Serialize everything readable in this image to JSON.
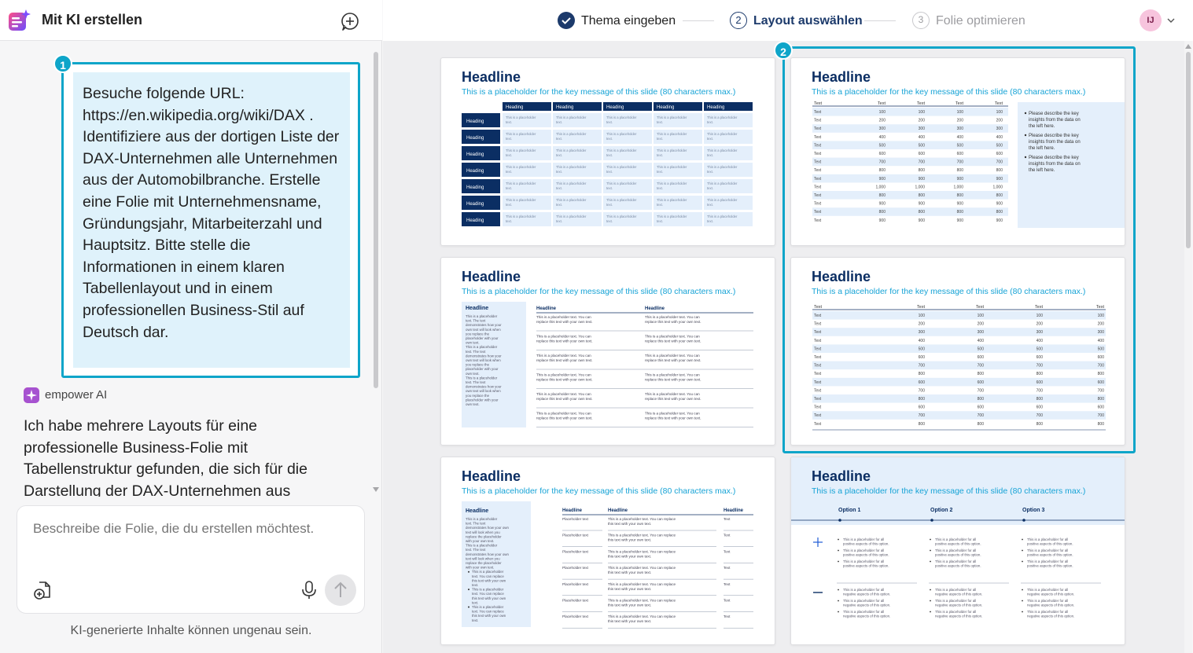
{
  "app": {
    "panel_title": "Mit KI erstellen"
  },
  "chat": {
    "badge_prompt": "1",
    "user_prompt": "Besuche folgende URL: https://en.wikipedia.org/wiki/DAX . Identifiziere aus der dortigen Liste der DAX-Unternehmen alle Unternehmen aus der Automobilbranche. Erstelle eine Folie mit Unternehmensname, Gründungsjahr, Mitarbeiterzahl und Hauptsitz. Bitte stelle die Informationen in einem klaren Tabellenlayout und in einem professionellen Business-Stil auf Deutsch dar.",
    "assistant_name": "empower AI",
    "assistant_message": "Ich habe mehrere Layouts für eine professionelle Business-Folie mit Tabellenstruktur gefunden, die sich für die Darstellung der DAX-Unternehmen aus"
  },
  "composer": {
    "placeholder": "Beschreibe die Folie, die du erstellen möchtest.",
    "disclaimer": "KI-generierte Inhalte können ungenau sein."
  },
  "steps": [
    {
      "number": "1",
      "label": "Thema eingeben",
      "state": "done"
    },
    {
      "number": "2",
      "label": "Layout auswählen",
      "state": "active"
    },
    {
      "number": "3",
      "label": "Folie optimieren",
      "state": "pending"
    }
  ],
  "user": {
    "initials": "IJ",
    "avatar_color": "#f7c4dd"
  },
  "gallery": {
    "selected_badge": "2",
    "slides": [
      {
        "headline": "Headline",
        "subtitle": "This is a placeholder for the key message of this slide (80 characters max.)"
      },
      {
        "headline": "Headline",
        "subtitle": "This is a placeholder for the key message of this slide (80 characters max.)"
      },
      {
        "headline": "Headline",
        "subtitle": "This is a placeholder for the key message of this slide (80 characters max.)"
      },
      {
        "headline": "Headline",
        "subtitle": "This is a placeholder for the key message of this slide (80 characters max.)"
      },
      {
        "headline": "Headline",
        "subtitle": "This is a placeholder for the key message of this slide (80 characters max.)"
      },
      {
        "headline": "Headline",
        "subtitle": "This is a placeholder for the key message of this slide (80 characters max.)"
      }
    ],
    "content": {
      "heading": "Heading",
      "text": "Text",
      "cell_text": "This is a placeholder text.",
      "wide_text": "This is a placeholder text. You can replace this text with your own text.",
      "placeholder_text": "Placeholder text",
      "headline_small": "Headline",
      "bullets": [
        "Please describe the key insights from the data on the left here.",
        "Please describe the key insights from the data on the left here.",
        "Please describe the key insights from the data on the left here."
      ],
      "values_a": [
        "100",
        "200",
        "300",
        "400",
        "500",
        "600",
        "700",
        "800",
        "900",
        "1,000",
        "800",
        "900",
        "800",
        "900"
      ],
      "values_b": [
        "100",
        "200",
        "300",
        "400",
        "500",
        "600",
        "700",
        "800",
        "600",
        "700",
        "800",
        "600",
        "700",
        "800"
      ],
      "options": [
        "Option 1",
        "Option 2",
        "Option 3"
      ],
      "positive_text": "This is a placeholder for all positive aspects of this option.",
      "negative_text": "This is a placeholder for all negative aspects of this option.",
      "side_text": "This is a placeholder text. The text demonstrates how your own text will look when you replace the placeholder with your own text."
    },
    "colors": {
      "navy": "#0b2e63",
      "accent": "#16a3d6",
      "light": "#e4effb",
      "select": "#0ea5c9"
    }
  }
}
